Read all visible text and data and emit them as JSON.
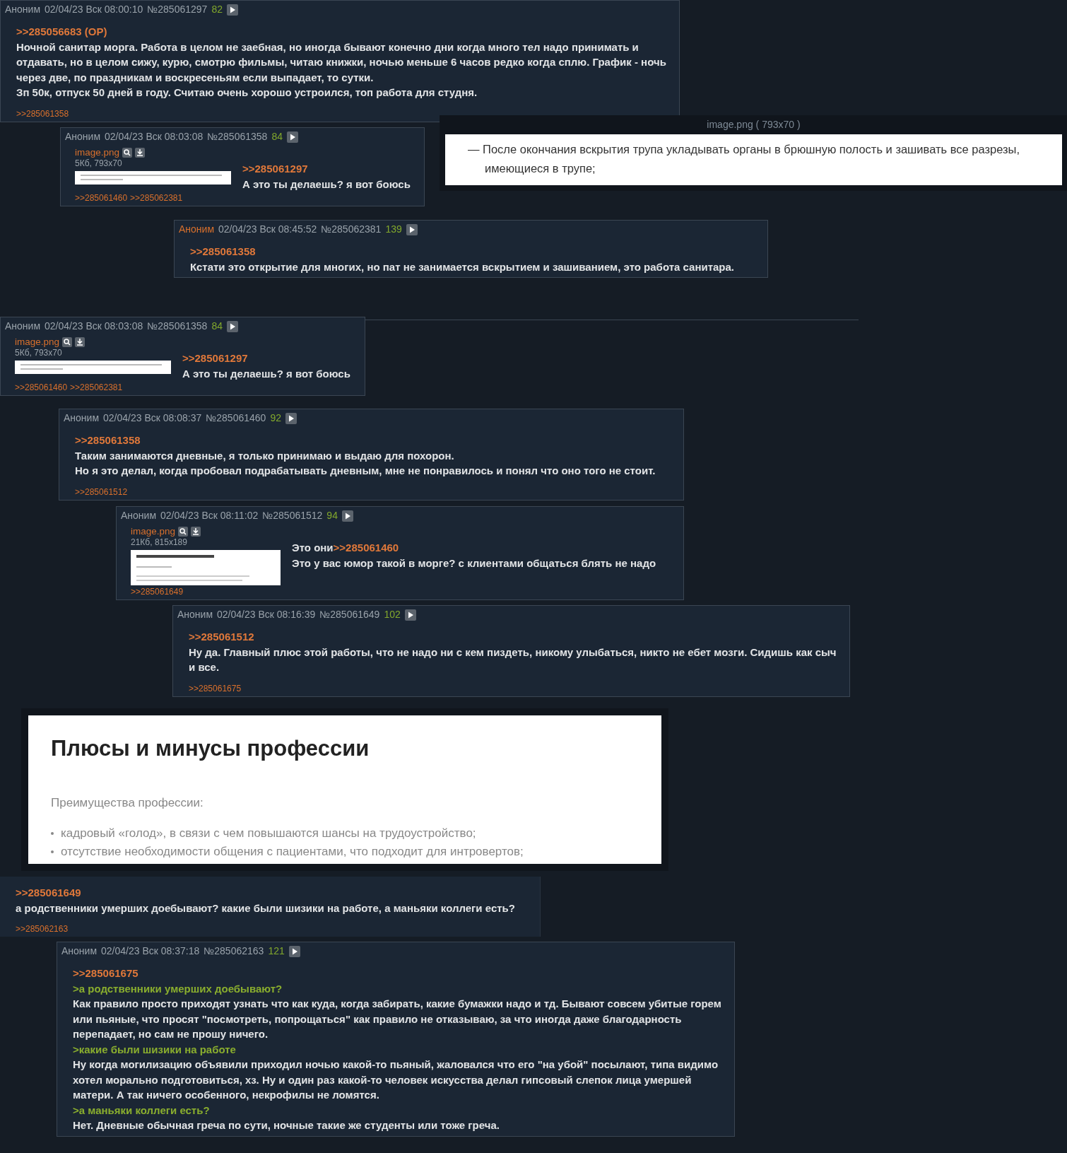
{
  "posts": [
    {
      "name": "Аноним",
      "highlighted": false,
      "date": "02/04/23 Вск 08:00:10",
      "number": "№285061297",
      "count": "82",
      "lines": [
        [
          {
            "kind": "link",
            "text": ">>285056683 (OP)"
          }
        ],
        [
          {
            "kind": "text",
            "text": "Ночной санитар морга. Работа в целом не заебная, но иногда бывают конечно дни когда много тел надо принимать и отдавать, но в целом сижу, курю, смотрю фильмы, читаю книжки, ночью меньше 6 часов редко когда сплю. График - ночь через две, по праздникам и воскресеньям если выпадает, то сутки."
          }
        ],
        [
          {
            "kind": "text",
            "text": "Зп 50к, отпуск 50 дней в году. Считаю очень хорошо устроился, топ работа для студня."
          }
        ]
      ],
      "replies": [
        ">>285061358"
      ]
    },
    {
      "name": "Аноним",
      "highlighted": false,
      "date": "02/04/23 Вск 08:03:08",
      "number": "№285061358",
      "count": "84",
      "file": {
        "name": "image.png",
        "meta": "5Кб, 793x70",
        "kind": "note"
      },
      "lines": [
        [
          {
            "kind": "link",
            "text": ">>285061297"
          }
        ],
        [
          {
            "kind": "text",
            "text": "А это ты делаешь? я вот боюсь"
          }
        ]
      ],
      "replies": [
        ">>285061460",
        ">>285062381"
      ]
    },
    {
      "name": "Аноним",
      "highlighted": true,
      "date": "02/04/23 Вск 08:45:52",
      "number": "№285062381",
      "count": "139",
      "lines": [
        [
          {
            "kind": "link",
            "text": ">>285061358"
          }
        ],
        [
          {
            "kind": "text",
            "text": "Кстати это открытие для многих, но пат не занимается вскрытием и зашиванием, это работа санитара."
          }
        ]
      ]
    },
    {
      "name": "Аноним",
      "highlighted": false,
      "date": "02/04/23 Вск 08:03:08",
      "number": "№285061358",
      "count": "84",
      "file": {
        "name": "image.png",
        "meta": "5Кб, 793x70",
        "kind": "note"
      },
      "lines": [
        [
          {
            "kind": "link",
            "text": ">>285061297"
          }
        ],
        [
          {
            "kind": "text",
            "text": "А это ты делаешь? я вот боюсь"
          }
        ]
      ],
      "replies": [
        ">>285061460",
        ">>285062381"
      ]
    },
    {
      "name": "Аноним",
      "highlighted": false,
      "date": "02/04/23 Вск 08:08:37",
      "number": "№285061460",
      "count": "92",
      "lines": [
        [
          {
            "kind": "link",
            "text": ">>285061358"
          }
        ],
        [
          {
            "kind": "text",
            "text": "Таким занимаются дневные, я только принимаю и выдаю для похорон."
          }
        ],
        [
          {
            "kind": "text",
            "text": "Но я это делал, когда пробовал подрабатывать дневным, мне не понравилось и понял что оно того не стоит."
          }
        ]
      ],
      "replies": [
        ">>285061512"
      ]
    },
    {
      "name": "Аноним",
      "highlighted": false,
      "date": "02/04/23 Вск 08:11:02",
      "number": "№285061512",
      "count": "94",
      "file": {
        "name": "image.png",
        "meta": "21Кб, 815x189",
        "kind": "list"
      },
      "lines": [
        [
          {
            "kind": "text",
            "text": "Это они"
          },
          {
            "kind": "link",
            "text": ">>285061460"
          }
        ],
        [
          {
            "kind": "text",
            "text": "Это у вас юмор такой в морге? с клиентами общаться блять не надо"
          }
        ]
      ],
      "replies": [
        ">>285061649"
      ]
    },
    {
      "name": "Аноним",
      "highlighted": false,
      "date": "02/04/23 Вск 08:16:39",
      "number": "№285061649",
      "count": "102",
      "lines": [
        [
          {
            "kind": "link",
            "text": ">>285061512"
          }
        ],
        [
          {
            "kind": "text",
            "text": "Ну да. Главный плюс этой работы, что не надо ни с кем пиздеть, никому улыбаться, никто не ебет мозги. Сидишь как сыч и все."
          }
        ]
      ],
      "replies": [
        ">>285061675"
      ]
    },
    {
      "lines": [
        [
          {
            "kind": "link",
            "text": ">>285061649"
          }
        ],
        [
          {
            "kind": "text",
            "text": "а родственники умерших доебывают? какие были шизики на работе, а маньяки коллеги есть?"
          }
        ]
      ],
      "replies": [
        ">>285062163"
      ]
    },
    {
      "name": "Аноним",
      "highlighted": false,
      "date": "02/04/23 Вск 08:37:18",
      "number": "№285062163",
      "count": "121",
      "lines": [
        [
          {
            "kind": "link",
            "text": ">>285061675"
          }
        ],
        [
          {
            "kind": "quote",
            "text": ">а родственники умерших доебывают?"
          }
        ],
        [
          {
            "kind": "text",
            "text": "Как правило просто приходят узнать что как куда, когда забирать, какие бумажки надо и тд. Бывают совсем убитые горем или пьяные, что просят \"посмотреть, попрощаться\" как правило не отказываю, за что иногда даже благодарность перепадает, но сам не прошу ничего."
          }
        ],
        [
          {
            "kind": "quote",
            "text": ">какие были шизики на работе"
          }
        ],
        [
          {
            "kind": "text",
            "text": "Ну когда могилизацию объявили приходил ночью какой-то пьяный, жаловался что его \"на убой\" посылают, типа видимо хотел морально подготовиться, хз. Ну и один раз какой-то человек искусства делал гипсовый слепок лица умершей матери. А так ничего особенного, некрофилы не ломятся."
          }
        ],
        [
          {
            "kind": "quote",
            "text": ">а маньяки коллеги есть?"
          }
        ],
        [
          {
            "kind": "text",
            "text": "Нет. Дневные обычная греча по сути, ночные такие же студенты или тоже греча."
          }
        ]
      ]
    }
  ],
  "image_viewers": [
    {
      "kind": "note",
      "caption": "image.png ( 793x70 )",
      "text": "— После окончания вскрытия трупа укладывать органы в брюшную полость и зашивать все разрезы, имеющиеся в трупе;"
    },
    {
      "kind": "list",
      "title": "Плюсы и минусы профессии",
      "subtitle": "Преимущества профессии:",
      "items": [
        "кадровый «голод», в связи с чем повышаются шансы на трудоустройство;",
        "отсутствие необходимости общения с пациентами, что подходит для интровертов;"
      ]
    }
  ]
}
